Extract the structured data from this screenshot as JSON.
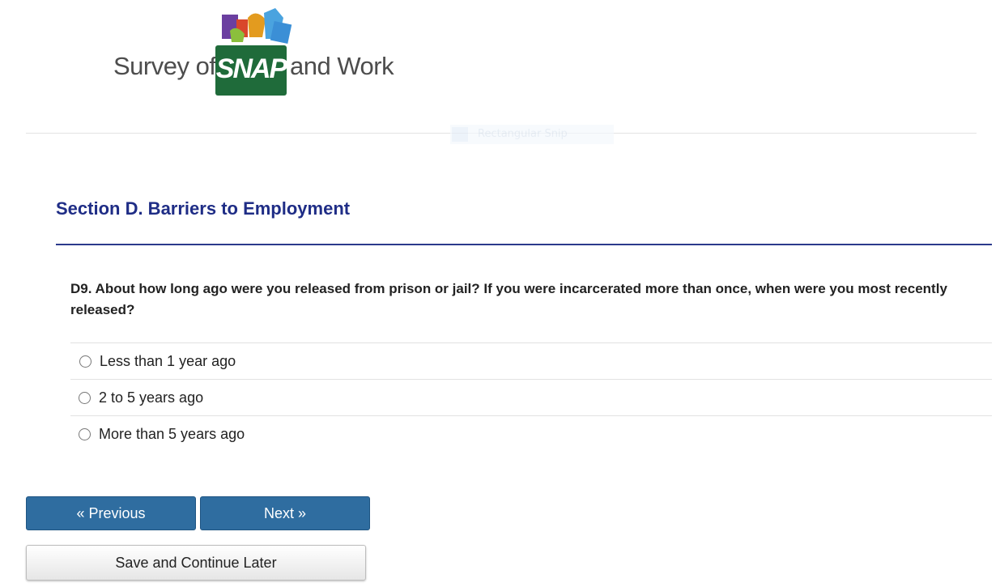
{
  "logo": {
    "word_left": "Survey of",
    "word_brand": "SNAP",
    "word_right": "and Work",
    "brand_color": "#1f6b3a"
  },
  "overlay": {
    "ghost_text": "Rectangular Snip"
  },
  "section": {
    "title": "Section D. Barriers to Employment",
    "title_color": "#1f2d86"
  },
  "question": {
    "text": "D9. About how long ago were you released from prison or jail? If you were incarcerated more than once, when were you most recently released?",
    "options": [
      {
        "label": "Less than 1 year ago",
        "selected": false
      },
      {
        "label": "2 to 5 years ago",
        "selected": false
      },
      {
        "label": "More than 5 years ago",
        "selected": false
      }
    ]
  },
  "nav": {
    "previous_label": "« Previous",
    "next_label": "Next »",
    "save_label": "Save and Continue Later",
    "primary_color": "#2f6da0"
  }
}
